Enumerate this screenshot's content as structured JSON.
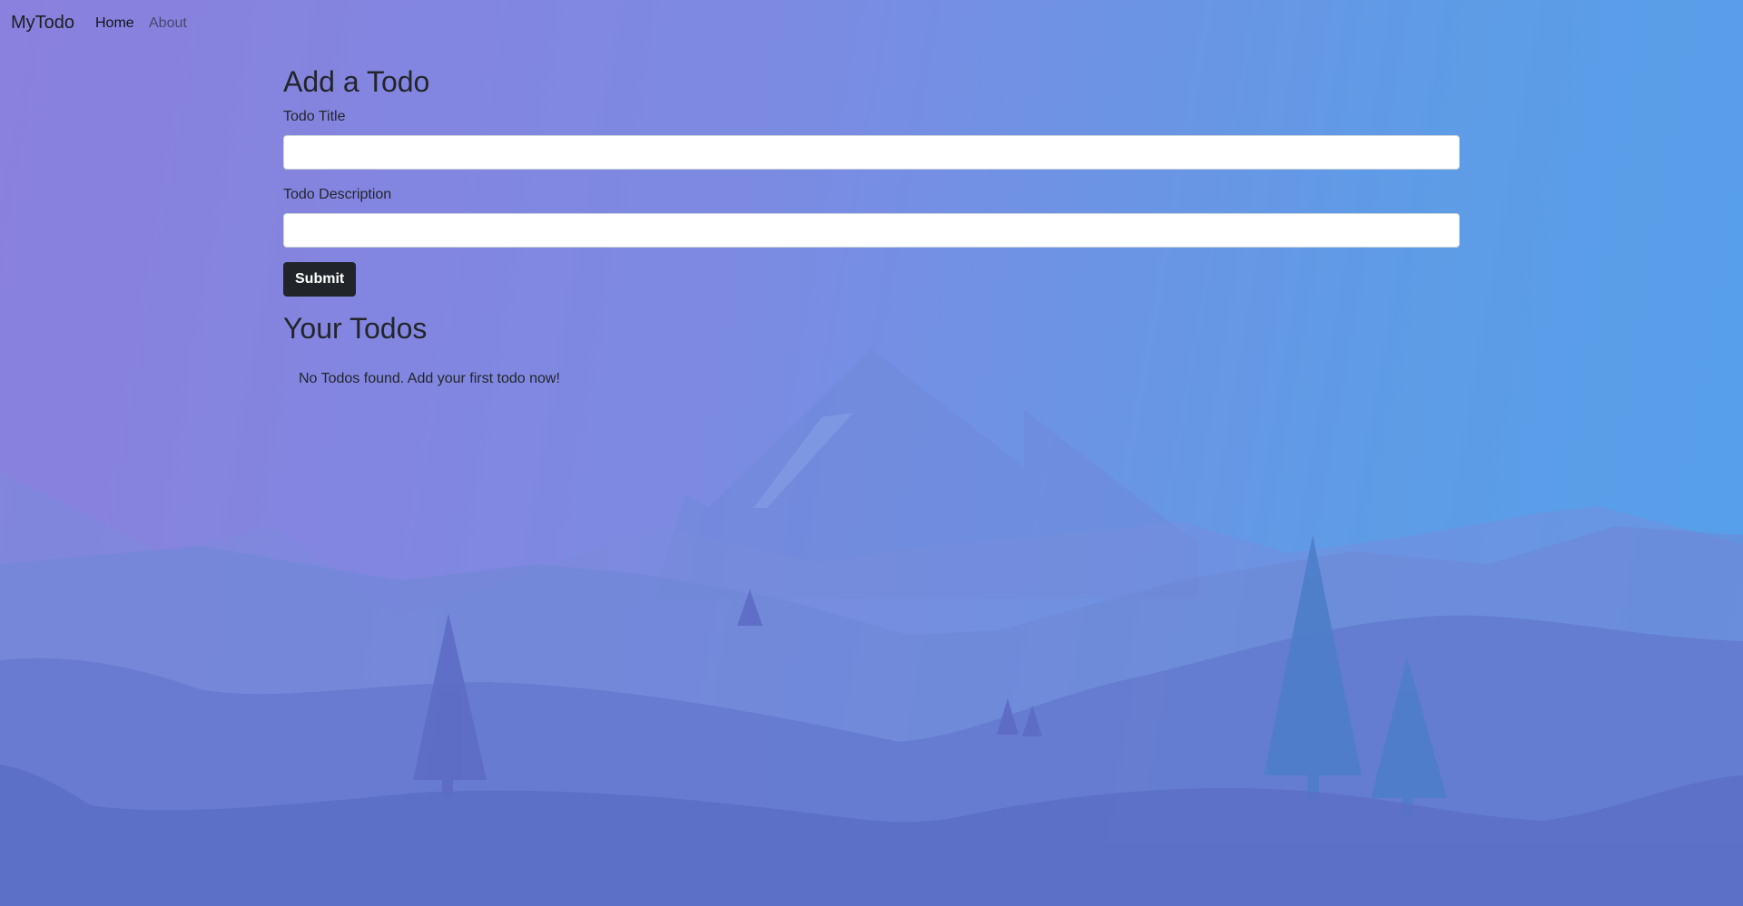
{
  "navbar": {
    "brand": "MyTodo",
    "links": [
      {
        "label": "Home",
        "active": true
      },
      {
        "label": "About",
        "active": false
      }
    ]
  },
  "form": {
    "heading": "Add a Todo",
    "title_label": "Todo Title",
    "title_value": "",
    "description_label": "Todo Description",
    "description_value": "",
    "submit_label": "Submit"
  },
  "todos": {
    "heading": "Your Todos",
    "empty_message": "No Todos found. Add your first todo now!",
    "items": []
  },
  "colors": {
    "gradient_left": "#8a80dd",
    "gradient_right": "#55a0ea",
    "button_bg": "#212529",
    "text": "#212529"
  }
}
